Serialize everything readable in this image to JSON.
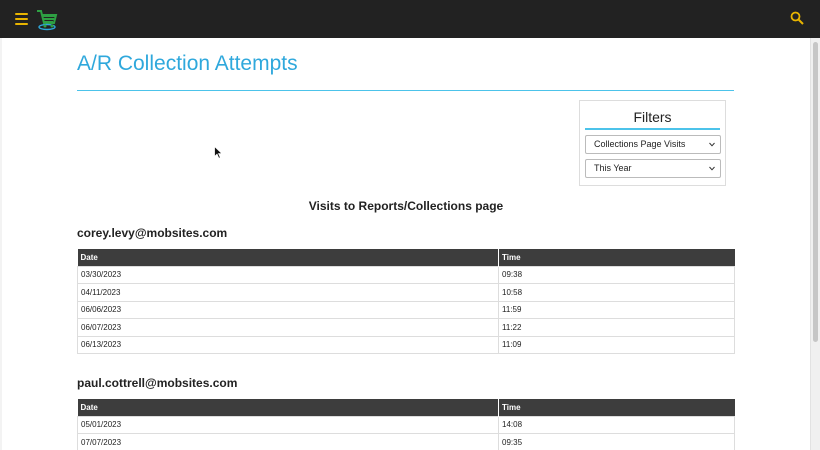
{
  "page": {
    "title": "A/R Collection Attempts",
    "report_heading": "Visits to Reports/Collections page"
  },
  "filters": {
    "title": "Filters",
    "report_type": "Collections Page Visits",
    "period": "This Year"
  },
  "users": [
    {
      "email": "corey.levy@mobsites.com",
      "columns": [
        "Date",
        "Time"
      ],
      "rows": [
        [
          "03/30/2023",
          "09:38"
        ],
        [
          "04/11/2023",
          "10:58"
        ],
        [
          "06/06/2023",
          "11:59"
        ],
        [
          "06/07/2023",
          "11:22"
        ],
        [
          "06/13/2023",
          "11:09"
        ]
      ]
    },
    {
      "email": "paul.cottrell@mobsites.com",
      "columns": [
        "Date",
        "Time"
      ],
      "rows": [
        [
          "05/01/2023",
          "14:08"
        ],
        [
          "07/07/2023",
          "09:35"
        ]
      ]
    }
  ],
  "icons": {
    "menu": "hamburger-icon",
    "logo": "shopping-cart-icon",
    "search": "search-icon"
  },
  "colors": {
    "accent": "#2fa8dc",
    "menu_icon": "#e8b400",
    "logo": "#2ea043",
    "table_header": "#3d3d3d"
  }
}
